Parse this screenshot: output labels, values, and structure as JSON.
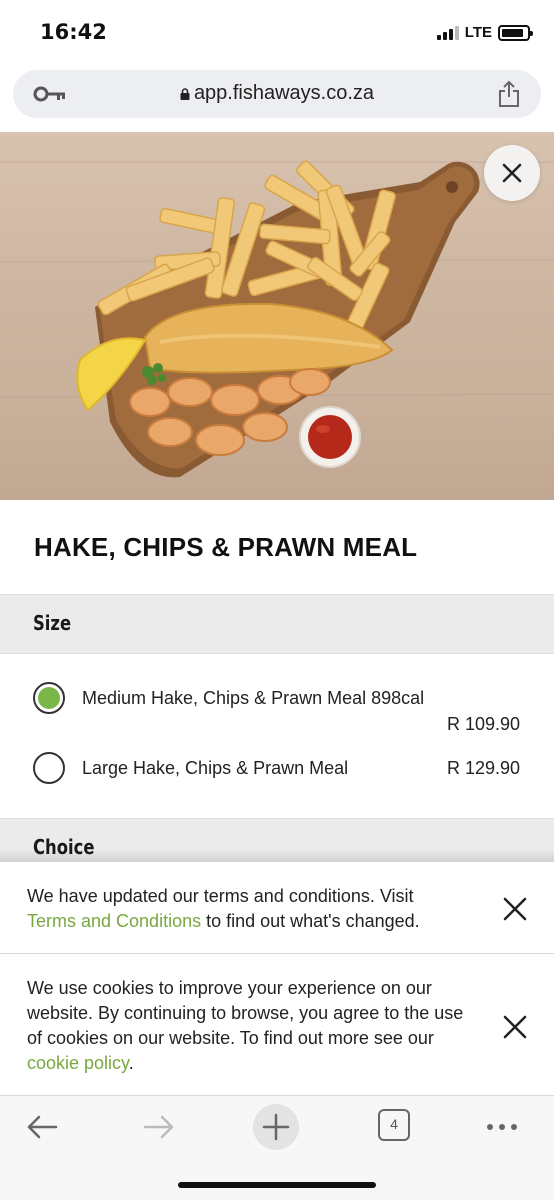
{
  "status_bar": {
    "time": "16:42",
    "network": "LTE"
  },
  "browser": {
    "url": "app.fishaways.co.za",
    "tab_count": "4"
  },
  "product": {
    "title": "HAKE, CHIPS & PRAWN MEAL"
  },
  "size_section": {
    "header": "Size",
    "options": [
      {
        "label": "Medium Hake, Chips & Prawn Meal 898cal",
        "price": "R 109.90",
        "selected": true
      },
      {
        "label": "Large Hake, Chips & Prawn Meal",
        "price": "R 129.90",
        "selected": false
      }
    ]
  },
  "choice_section": {
    "header": "Choice"
  },
  "terms_notice": {
    "text_before": "We have updated our terms and conditions. Visit",
    "link": "Terms and Conditions",
    "text_after": " to find out what's changed."
  },
  "cookie_notice": {
    "text_before": "We use cookies to improve your experience on our website. By continuing to browse, you agree to the use of cookies on our website. To find out more see our ",
    "link": "cookie policy",
    "text_after": "."
  },
  "colors": {
    "accent_green": "#7ab648",
    "link_green": "#78a83f"
  },
  "icons": [
    "key-icon",
    "lock-icon",
    "share-icon",
    "close-icon",
    "back-arrow-icon",
    "forward-arrow-icon",
    "new-tab-plus-icon",
    "tabs-icon",
    "more-dots-icon"
  ]
}
